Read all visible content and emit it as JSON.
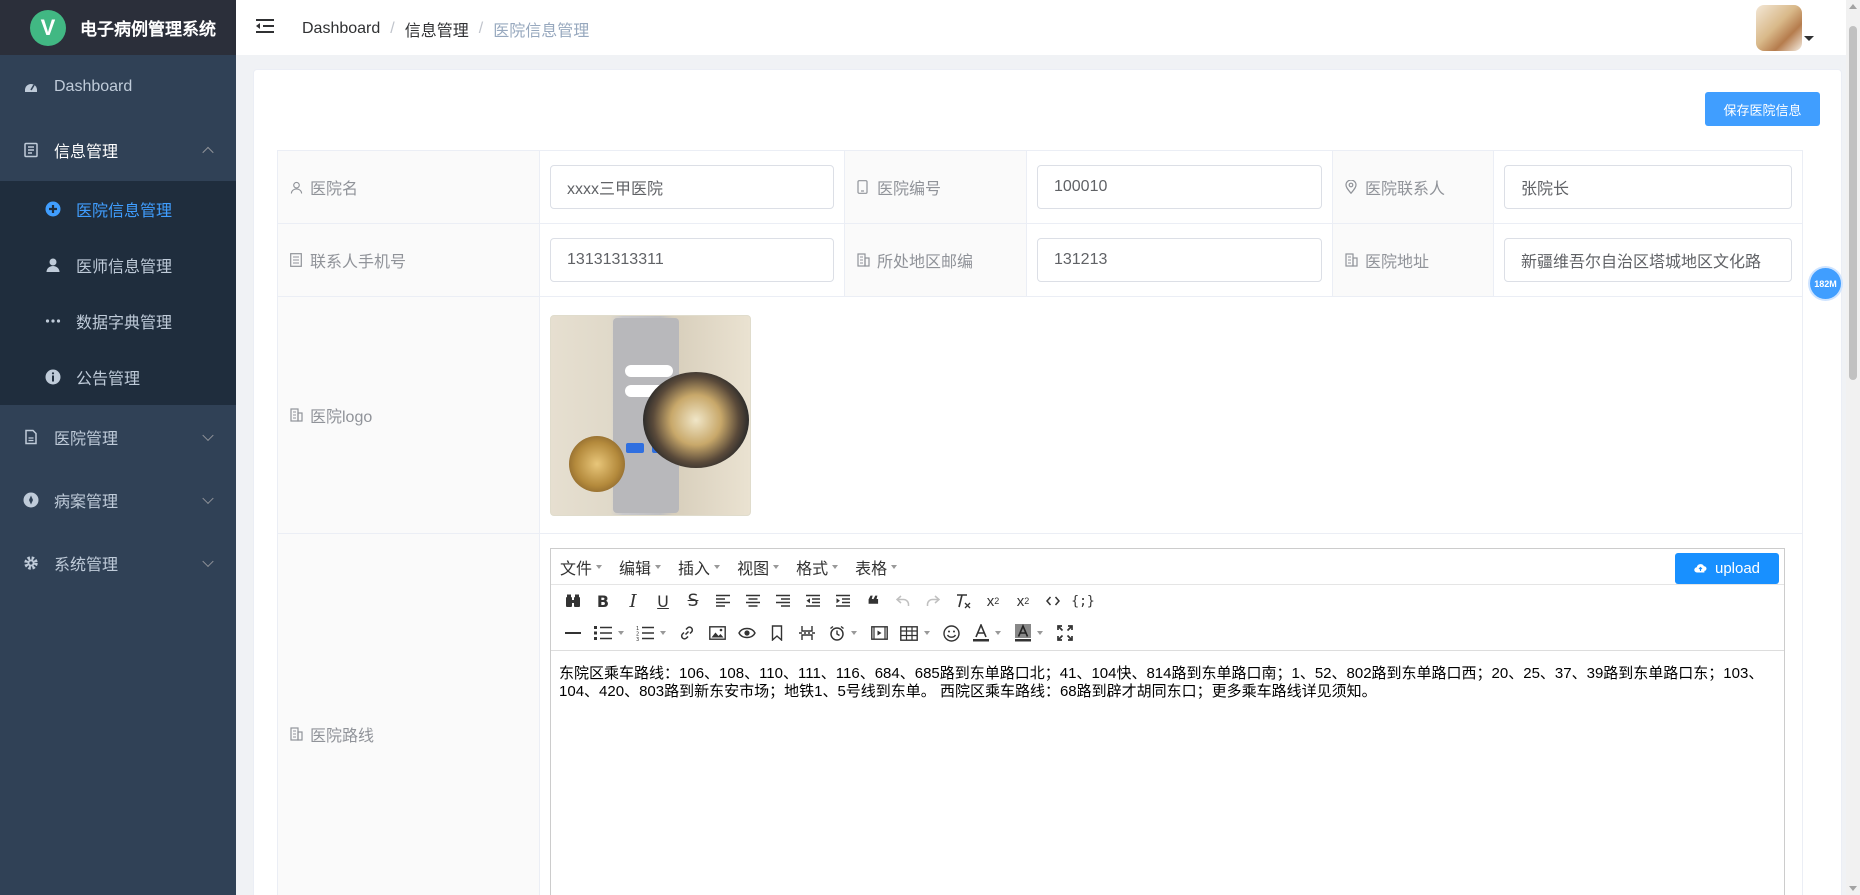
{
  "app": {
    "title": "电子病例管理系统",
    "logo_letter": "V"
  },
  "sidebar": {
    "items": [
      {
        "label": "Dashboard",
        "icon": "dashboard-icon"
      },
      {
        "label": "信息管理",
        "icon": "document-icon",
        "expanded": true,
        "children": [
          {
            "label": "医院信息管理",
            "icon": "hospital-icon",
            "active": true
          },
          {
            "label": "医师信息管理",
            "icon": "user-icon"
          },
          {
            "label": "数据字典管理",
            "icon": "more-icon"
          },
          {
            "label": "公告管理",
            "icon": "info-icon"
          }
        ]
      },
      {
        "label": "医院管理",
        "icon": "file-icon"
      },
      {
        "label": "病案管理",
        "icon": "compass-icon"
      },
      {
        "label": "系统管理",
        "icon": "gear-icon"
      }
    ],
    "active_color": "#409eff"
  },
  "header": {
    "breadcrumb": [
      "Dashboard",
      "信息管理",
      "医院信息管理"
    ]
  },
  "toolbar": {
    "save_label": "保存医院信息"
  },
  "form": {
    "name_label": "医院名",
    "name_value": "xxxx三甲医院",
    "code_label": "医院编号",
    "code_value": "100010",
    "contact_label": "医院联系人",
    "contact_value": "张院长",
    "phone_label": "联系人手机号",
    "phone_value": "13131313311",
    "zip_label": "所处地区邮编",
    "zip_value": "131213",
    "address_label": "医院地址",
    "address_value": "新疆维吾尔自治区塔城地区文化路",
    "logo_label": "医院logo",
    "route_label": "医院路线"
  },
  "editor": {
    "menus": [
      "文件",
      "编辑",
      "插入",
      "视图",
      "格式",
      "表格"
    ],
    "upload_label": "upload",
    "content": "东院区乘车路线：106、108、110、111、116、684、685路到东单路口北；41、104快、814路到东单路口南；1、52、802路到东单路口西；20、25、37、39路到东单路口东；103、104、420、803路到新东安市场；地铁1、5号线到东单。 西院区乘车路线：68路到辟才胡同东口；更多乘车路线详见须知。"
  },
  "float_badge": "182M",
  "colors": {
    "primary": "#409eff",
    "sidebar_bg": "#304156",
    "submenu_bg": "#1f2d3d"
  }
}
